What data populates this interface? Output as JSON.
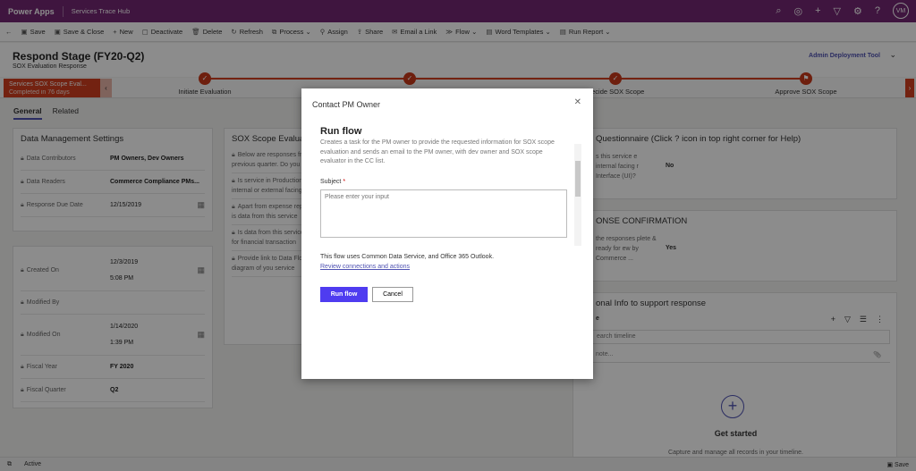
{
  "topbar": {
    "app": "Power Apps",
    "env": "Services Trace Hub",
    "avatar": "VM",
    "icons": [
      "search-icon",
      "target-icon",
      "plus-icon",
      "filter-icon",
      "gear-icon",
      "help-icon"
    ]
  },
  "toolbar": {
    "items": [
      "Save",
      "Save & Close",
      "New",
      "Deactivate",
      "Delete",
      "Refresh",
      "Process",
      "Assign",
      "Share",
      "Email a Link",
      "Flow",
      "Word Templates",
      "Run Report"
    ]
  },
  "header": {
    "title": "Respond Stage (FY20-Q2)",
    "subtitle": "SOX Evaluation Response",
    "tool": "Admin Deployment Tool"
  },
  "bpf": {
    "active_name": "Services SOX Scope Eval...",
    "active_status": "Completed in 76 days",
    "stages": [
      "Initiate Evaluation",
      "",
      "Decide SOX Scope",
      "Approve SOX Scope"
    ]
  },
  "tabs": [
    "General",
    "Related"
  ],
  "data_mgmt": {
    "title": "Data Management Settings",
    "rows": [
      {
        "label": "Data Contributors",
        "value": "PM Owners, Dev Owners"
      },
      {
        "label": "Data Readers",
        "value": "Commerce Compliance PMs..."
      },
      {
        "label": "Response Due Date",
        "value": "12/15/2019"
      }
    ]
  },
  "audit": {
    "created_label": "Created On",
    "created_date": "12/3/2019",
    "created_time": "5:08 PM",
    "modified_by_label": "Modified By",
    "modified_label": "Modified On",
    "modified_date": "1/14/2020",
    "modified_time": "1:39 PM",
    "fy_label": "Fiscal Year",
    "fy": "FY 2020",
    "fq_label": "Fiscal Quarter",
    "fq": "Q2"
  },
  "sox": {
    "title": "SOX Scope Evaluati",
    "questions": [
      "Below are responses from previous quarter. Do you wan",
      "Is service in Production; internal or external facing. G",
      "Apart from expense reporting, is data from this service",
      "Is data from this service used for financial transaction",
      "Provide link to Data Flow diagram of you service"
    ]
  },
  "questionnaire": {
    "title": "Questionnaire (Click ? icon in top right corner for Help)",
    "q": "s this service e internal facing r Interface (UI)?",
    "a": "No"
  },
  "confirmation": {
    "title": "ONSE CONFIRMATION",
    "q": "the responses plete & ready for ew by Commerce ...",
    "a": "Yes"
  },
  "timeline": {
    "title": "onal Info to support response",
    "label": "e",
    "search": "earch timeline",
    "note": "note...",
    "get_started": "Get started",
    "caption": "Capture and manage all records in your timeline."
  },
  "modal": {
    "title": "Contact PM Owner",
    "heading": "Run flow",
    "description": "Creates a task for the PM owner to provide the requested information for SOX scope evaluation and sends an email to the PM owner, with dev owner and SOX scope evaluator in the CC list.",
    "subject_label": "Subject",
    "required": "*",
    "placeholder": "Please enter your input",
    "uses": "This flow uses Common Data Service, and Office 365 Outlook.",
    "review_link": "Review connections and actions",
    "run": "Run flow",
    "cancel": "Cancel"
  },
  "status": {
    "state": "Active",
    "save": "Save"
  }
}
